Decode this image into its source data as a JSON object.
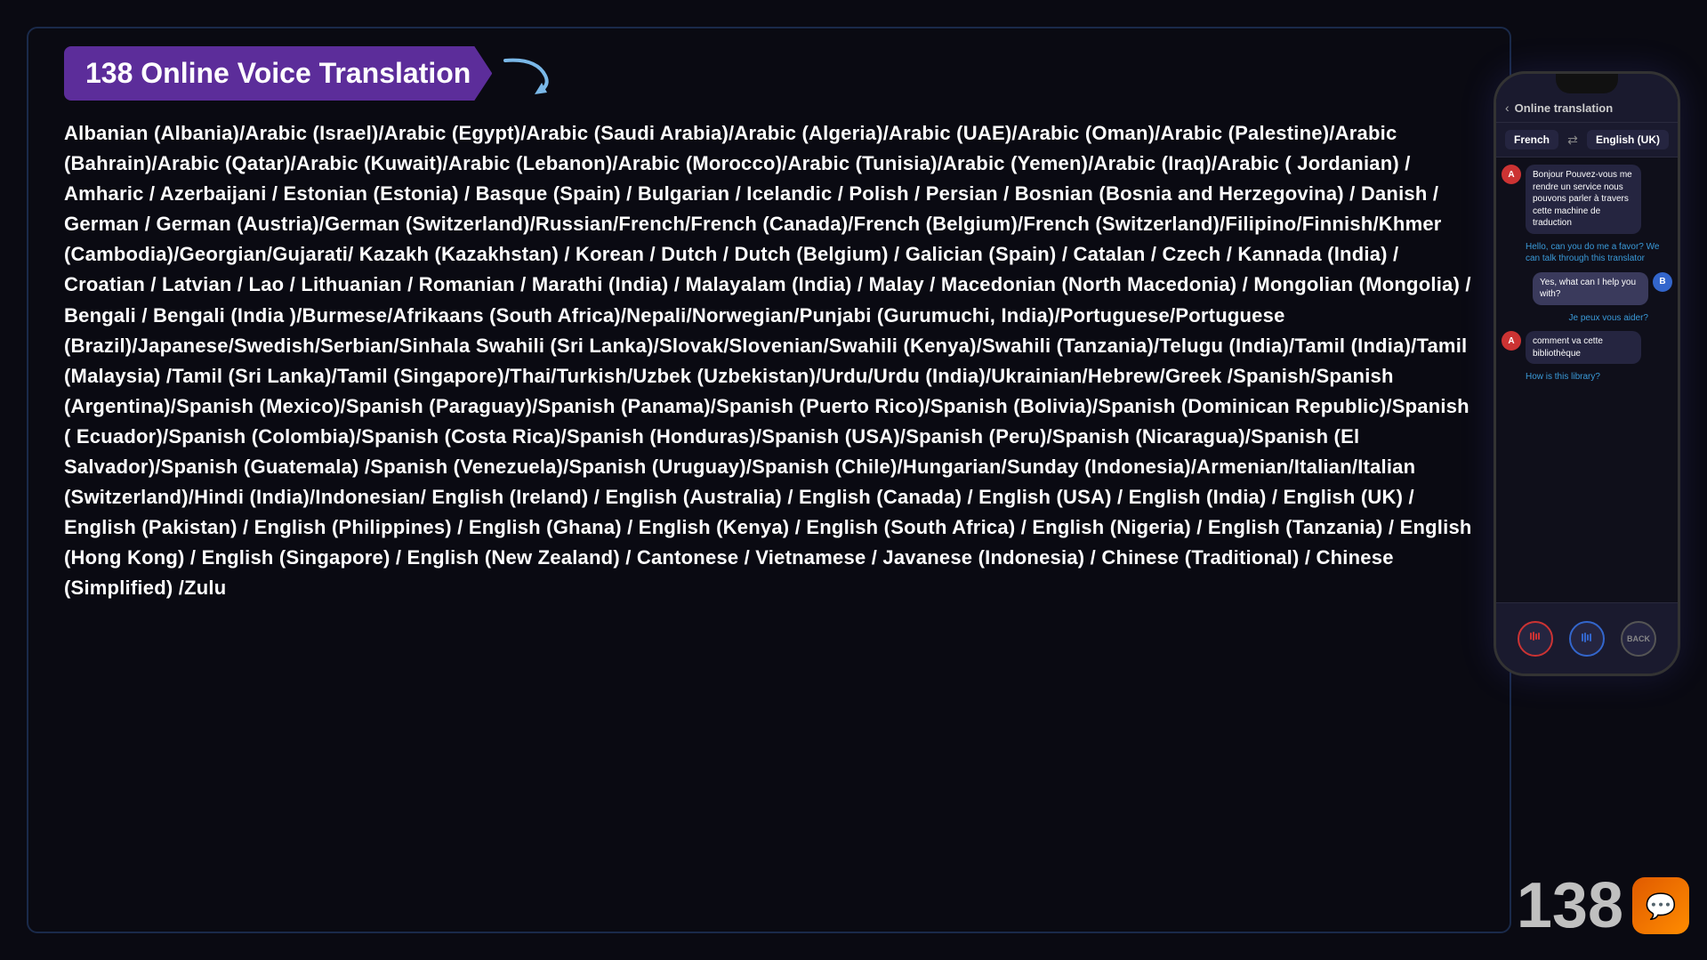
{
  "title": "138 Online Voice Translation",
  "arrow": "→",
  "languages_text": "Albanian (Albania)/Arabic (Israel)/Arabic (Egypt)/Arabic (Saudi Arabia)/Arabic (Algeria)/Arabic (UAE)/Arabic (Oman)/Arabic (Palestine)/Arabic (Bahrain)/Arabic (Qatar)/Arabic (Kuwait)/Arabic (Lebanon)/Arabic (Morocco)/Arabic (Tunisia)/Arabic (Yemen)/Arabic (Iraq)/Arabic ( Jordanian) / Amharic / Azerbaijani / Estonian (Estonia) / Basque (Spain) / Bulgarian / Icelandic / Polish / Persian / Bosnian (Bosnia and Herzegovina) / Danish / German / German (Austria)/German (Switzerland)/Russian/French/French (Canada)/French (Belgium)/French (Switzerland)/Filipino/Finnish/Khmer (Cambodia)/Georgian/Gujarati/ Kazakh (Kazakhstan) / Korean / Dutch / Dutch (Belgium) / Galician (Spain) / Catalan / Czech / Kannada (India) / Croatian / Latvian / Lao / Lithuanian / Romanian / Marathi (India) / Malayalam (India) / Malay / Macedonian (North Macedonia) / Mongolian (Mongolia) / Bengali / Bengali (India )/Burmese/Afrikaans (South Africa)/Nepali/Norwegian/Punjabi (Gurumuchi, India)/Portuguese/Portuguese (Brazil)/Japanese/Swedish/Serbian/Sinhala Swahili (Sri Lanka)/Slovak/Slovenian/Swahili (Kenya)/Swahili (Tanzania)/Telugu (India)/Tamil (India)/Tamil (Malaysia) /Tamil (Sri Lanka)/Tamil (Singapore)/Thai/Turkish/Uzbek (Uzbekistan)/Urdu/Urdu (India)/Ukrainian/Hebrew/Greek /Spanish/Spanish (Argentina)/Spanish (Mexico)/Spanish (Paraguay)/Spanish (Panama)/Spanish (Puerto Rico)/Spanish (Bolivia)/Spanish (Dominican Republic)/Spanish ( Ecuador)/Spanish (Colombia)/Spanish (Costa Rica)/Spanish (Honduras)/Spanish (USA)/Spanish (Peru)/Spanish (Nicaragua)/Spanish (El Salvador)/Spanish (Guatemala) /Spanish (Venezuela)/Spanish (Uruguay)/Spanish (Chile)/Hungarian/Sunday (Indonesia)/Armenian/Italian/Italian (Switzerland)/Hindi (India)/Indonesian/ English (Ireland) / English (Australia) / English (Canada) / English (USA) / English (India) / English (UK) / English (Pakistan) / English (Philippines) / English (Ghana) / English (Kenya) / English (South Africa) / English (Nigeria) / English (Tanzania) / English (Hong Kong) / English (Singapore) / English (New Zealand) / Cantonese / Vietnamese / Javanese (Indonesia) / Chinese (Traditional) / Chinese (Simplified) /Zulu",
  "phone": {
    "header_back": "‹",
    "header_title": "Online translation",
    "lang_from": "French",
    "lang_to": "English (UK)",
    "swap_icon": "⇄",
    "messages": [
      {
        "side": "left",
        "avatar": "A",
        "text": "Bonjour Pouvez-vous me rendre un service nous pouvons parler à travers cette machine de traduction",
        "translation": "Hello, can you do me a favor? We can talk through this translator"
      },
      {
        "side": "right",
        "avatar": "B",
        "text": "Yes, what can I help you with?",
        "translation": "Je peux vous aider?"
      },
      {
        "side": "left",
        "avatar": "A",
        "text": "comment va cette bibliothèque",
        "translation": "How is this library?"
      }
    ],
    "btn_back_label": "BACK"
  },
  "branding": {
    "number": "138",
    "icon": "💬"
  }
}
